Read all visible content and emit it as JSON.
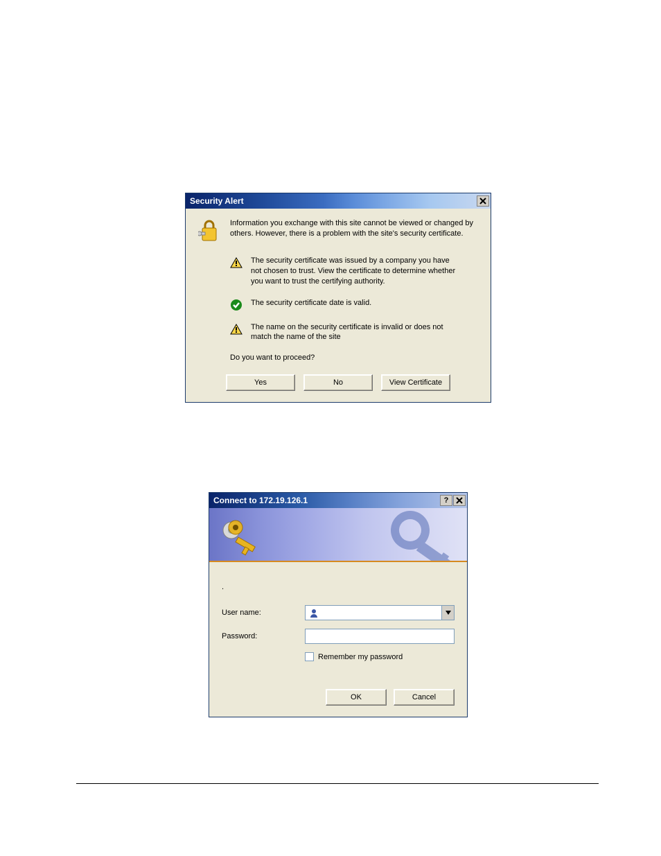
{
  "security_alert": {
    "title": "Security Alert",
    "intro": "Information you exchange with this site cannot be viewed or changed by others. However, there is a problem with the site's security certificate.",
    "items": [
      {
        "status": "warning",
        "text": "The security certificate was issued by a company you have not chosen to trust. View the certificate to determine whether you want to trust the certifying authority."
      },
      {
        "status": "ok",
        "text": "The security certificate date is valid."
      },
      {
        "status": "warning",
        "text": "The name on the security certificate is invalid or does not match the name of the site"
      }
    ],
    "proceed_question": "Do you want to proceed?",
    "buttons": {
      "yes": "Yes",
      "no": "No",
      "view_cert": "View Certificate"
    },
    "icons": {
      "main": "lock-key-icon",
      "warning": "warning-triangle-icon",
      "ok": "check-circle-icon"
    }
  },
  "connect_dialog": {
    "title": "Connect to 172.19.126.1",
    "banner_icon_left": "keys-icon",
    "banner_icon_right": "key-silhouette-icon",
    "server_label": ".",
    "fields": {
      "username_label": "User name:",
      "username_value": "",
      "password_label": "Password:",
      "password_value": "",
      "remember_label": "Remember my password",
      "remember_checked": false
    },
    "buttons": {
      "ok": "OK",
      "cancel": "Cancel"
    }
  }
}
